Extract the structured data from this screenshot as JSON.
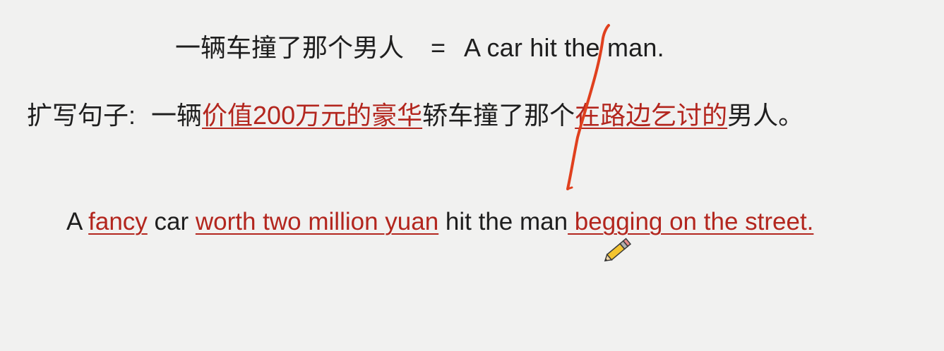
{
  "line1": {
    "chinese": "一辆车撞了那个男人",
    "equals": "=",
    "english": "A  car hit the man."
  },
  "line2": {
    "label": "扩写句子:",
    "seg1": "一辆",
    "seg2": "价值200万元的豪华",
    "seg3": "轿车撞了那个",
    "seg4": "在路边乞讨的",
    "seg5": "男人。"
  },
  "line3": {
    "w1": "A ",
    "w2": "fancy",
    "w3": " car ",
    "w4": "worth two million yuan",
    "w5": " hit the man",
    "w6": " begging on the street."
  },
  "colors": {
    "background": "#f1f1f0",
    "text": "#1e1e1e",
    "highlight": "#b3261e",
    "annotation_stroke": "#e0401e"
  },
  "icons": {
    "cursor": "pencil-icon"
  }
}
